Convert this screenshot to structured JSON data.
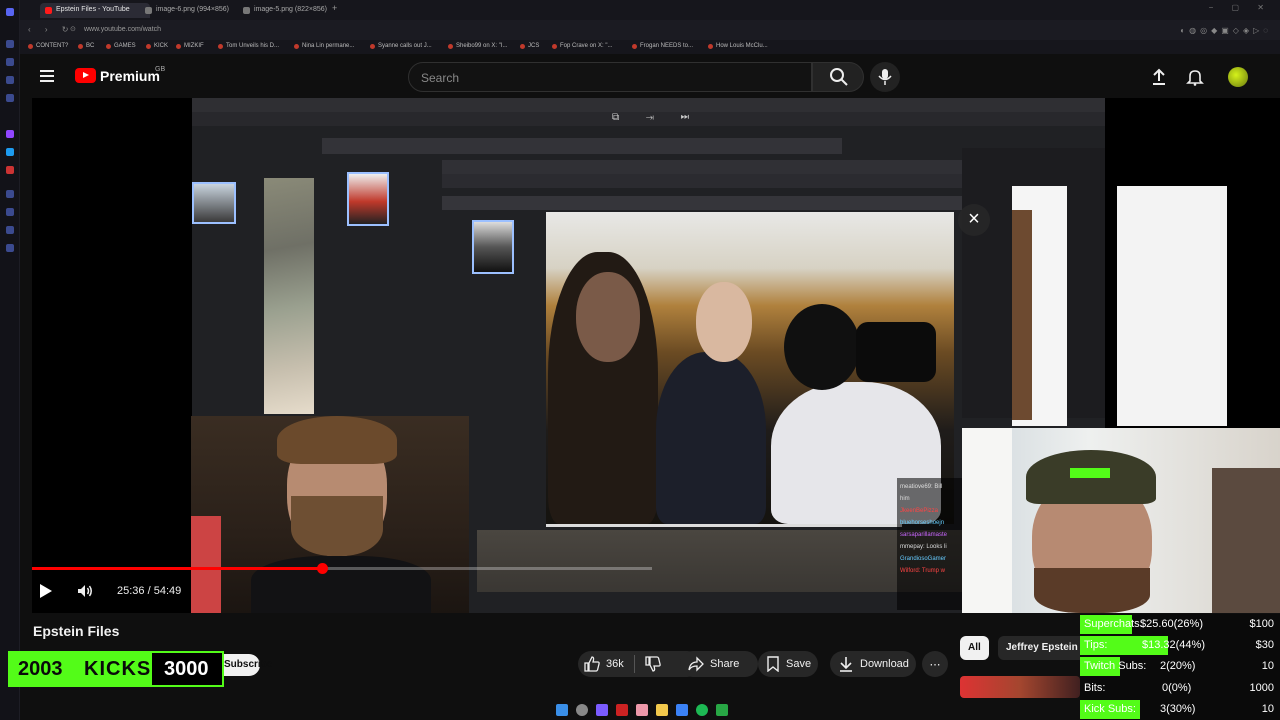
{
  "browser": {
    "tabs": [
      {
        "label": "Epstein Files - YouTube",
        "active": true
      },
      {
        "label": "image-6.png (994×856)",
        "active": false
      },
      {
        "label": "image-5.png (822×856)",
        "active": false
      }
    ],
    "url": "www.youtube.com/watch",
    "bookmarks": [
      "CONTENT?",
      "BC",
      "GAMES",
      "KICK",
      "MIZKIF",
      "Tom Unveils his D...",
      "Nina Lin permane...",
      "Syanne calls out J...",
      "Sheibo99 on X: \"I...",
      "JCS",
      "Fop Crave on X: \"...",
      "Frogan NEEDS to...",
      "How Louis McClu..."
    ]
  },
  "header": {
    "logo_text": "Premium",
    "country_code": "GB",
    "search_placeholder": "Search"
  },
  "player": {
    "time_current": "25:36",
    "time_separator": " / ",
    "time_total": "54:49",
    "progress_fraction": 0.467,
    "chat_lines": [
      "meatiove69: Bill",
      "him",
      "JkeenBePizza",
      "bluehorseshoejn",
      "sarsaparillamaste",
      "mmepay: Looks li",
      "GrandiosoGamer",
      "Wilford: Trump w"
    ]
  },
  "video": {
    "title": "Epstein Files",
    "subscribe_label": "Subscribe",
    "like_count": "36k",
    "share_label": "Share",
    "save_label": "Save",
    "download_label": "Download",
    "more_label": "⋯"
  },
  "chips": {
    "all": "All",
    "jeffrey": "Jeffrey Epstein"
  },
  "kick_widget": {
    "current": "2003",
    "label": "KICKS",
    "goal": "3000"
  },
  "goals": [
    {
      "label": "Superchats:",
      "current": "$25.60(26%)",
      "target": "$100",
      "fraction": 0.26
    },
    {
      "label": "Tips:",
      "current": "$13.32(44%)",
      "target": "$30",
      "fraction": 0.44
    },
    {
      "label": "Twitch Subs:",
      "current": "2(20%)",
      "target": "10",
      "fraction": 0.2
    },
    {
      "label": "Bits:",
      "current": "0(0%)",
      "target": "1000",
      "fraction": 0.0
    },
    {
      "label": "Kick Subs:",
      "current": "3(30%)",
      "target": "10",
      "fraction": 0.3
    }
  ],
  "colors": {
    "brand_red": "#ff0000",
    "kick_green": "#53fc18",
    "background": "#0f0f0f"
  }
}
